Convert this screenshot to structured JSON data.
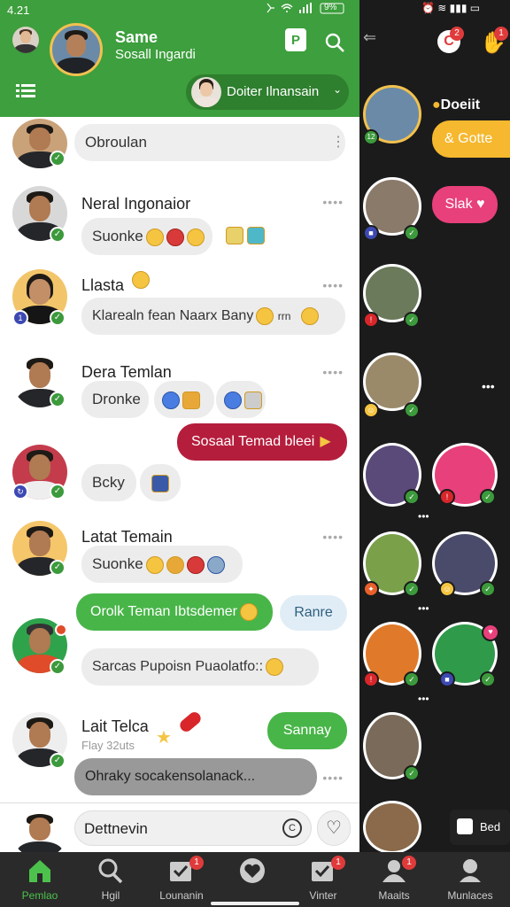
{
  "status": {
    "time": "4.21",
    "battery": "9%"
  },
  "header": {
    "title": "Same",
    "subtitle": "Sosall Ingardi",
    "account_chip": "Doiter Ilnansain",
    "colors": {
      "green": "#3d9f3d"
    }
  },
  "chats": [
    {
      "bubble": "Obroulan",
      "avatar_badge": "✓"
    },
    {
      "name": "Neral Ingonaior",
      "bubble": "Suonke",
      "small_badge": "",
      "avatar_badge": "✓"
    },
    {
      "name": "Llasta",
      "bubble": "Klarealn fean  Naarx Bany",
      "bubble_tail": "rrn",
      "avatar_badge": "✓",
      "left_badge": "1"
    },
    {
      "name": "Dera Temlan",
      "bubble": "Dronke",
      "avatar_badge": "✓"
    },
    {
      "outgoing": "Sosaal Temad bleei",
      "bubble": "Bcky",
      "avatar_badge": "✓"
    },
    {
      "name": "Latat Temain",
      "bubble": "Suonke",
      "avatar_badge": "✓"
    },
    {
      "outgoing": "Orolk Teman Ibtsdemer",
      "side_bubble": "Ranre",
      "bubble": "Sarcas Pupoisn Puaolatfo::",
      "avatar_badge": "✓"
    },
    {
      "name": "Lait Telca",
      "sub": "Flay 32uts",
      "outgoing": "Sannay",
      "bubble": "Ohraky socakensolanack...",
      "avatar_badge": "✓"
    },
    {
      "input_placeholder": "Dettnevin"
    }
  ],
  "right_panel": {
    "name": "Doeiit",
    "button": "Gotte",
    "pill": "Slak",
    "small_button": "Bed",
    "badges": [
      "2",
      "1"
    ],
    "pill_color": "#e8407a",
    "button_color": "#f5b82e"
  },
  "nav": [
    {
      "label": "Pemlao",
      "icon": "home-icon",
      "active": true
    },
    {
      "label": "Hgil",
      "icon": "search-icon"
    },
    {
      "label": "Lounanin",
      "icon": "tasks-icon",
      "badge": "1"
    },
    {
      "label": "",
      "icon": "heart-icon"
    },
    {
      "label": "Vinter",
      "icon": "checkbox-icon",
      "badge": "1"
    },
    {
      "label": "Maaits",
      "icon": "people-icon",
      "badge": "1"
    },
    {
      "label": "Munlaces",
      "icon": "profile-icon"
    }
  ]
}
